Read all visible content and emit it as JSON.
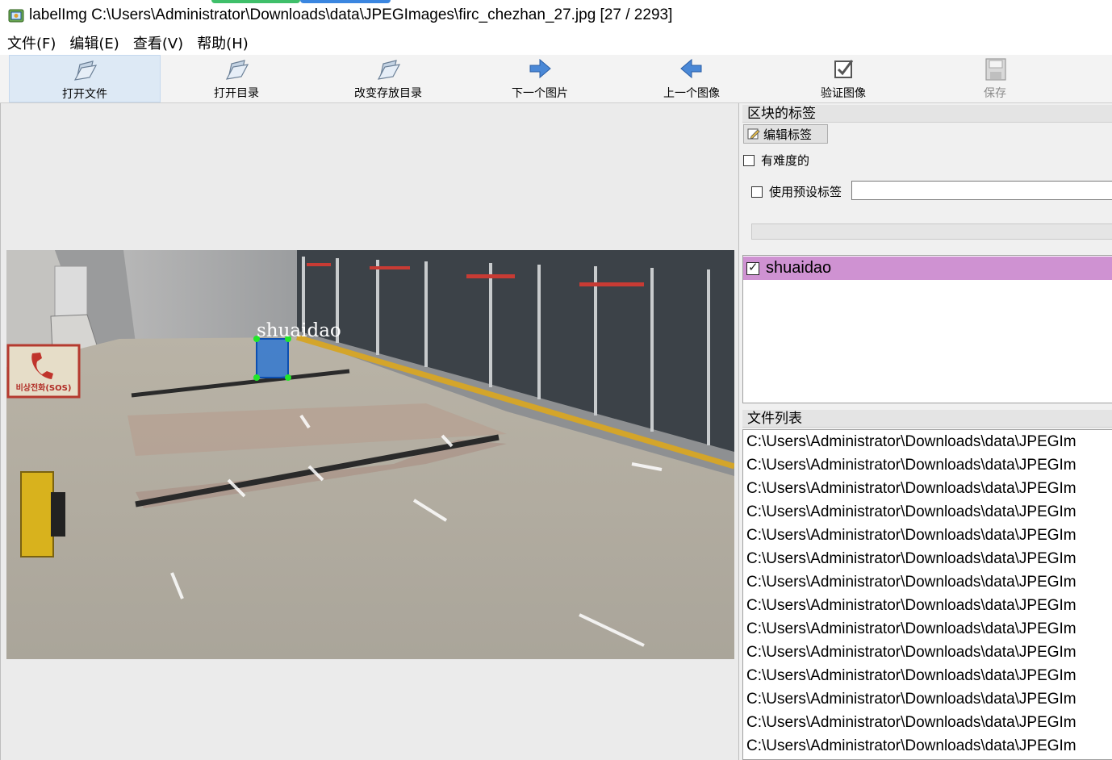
{
  "window": {
    "title": "labelImg C:\\Users\\Administrator\\Downloads\\data\\JPEGImages\\firc_chezhan_27.jpg [27 / 2293]"
  },
  "menu": [
    "文件(F)",
    "编辑(E)",
    "查看(V)",
    "帮助(H)"
  ],
  "toolbar": [
    {
      "label": "打开文件",
      "icon": "open-folder-icon",
      "active": true,
      "disabled": false
    },
    {
      "label": "打开目录",
      "icon": "open-folder-icon",
      "active": false,
      "disabled": false
    },
    {
      "label": "改变存放目录",
      "icon": "open-folder-icon",
      "active": false,
      "disabled": false
    },
    {
      "label": "下一个图片",
      "icon": "arrow-right-icon",
      "active": false,
      "disabled": false
    },
    {
      "label": "上一个图像",
      "icon": "arrow-left-icon",
      "active": false,
      "disabled": false
    },
    {
      "label": "验证图像",
      "icon": "check-box-icon",
      "active": false,
      "disabled": false
    },
    {
      "label": "保存",
      "icon": "save-disk-icon",
      "active": false,
      "disabled": true
    }
  ],
  "canvas": {
    "annotation_label": "shuaidao",
    "sign_text": "비상전화(SOS)"
  },
  "right_panel": {
    "box_labels_title": "区块的标签",
    "edit_label_button": "编辑标签",
    "difficult_label": "有难度的",
    "difficult_checked": false,
    "use_default_label": "使用预设标签",
    "use_default_checked": false,
    "default_label_value": "",
    "labels": [
      {
        "text": "shuaidao",
        "checked": true,
        "color": "#cf92d2"
      }
    ],
    "file_list_title": "文件列表",
    "files": [
      "C:\\Users\\Administrator\\Downloads\\data\\JPEGIm",
      "C:\\Users\\Administrator\\Downloads\\data\\JPEGIm",
      "C:\\Users\\Administrator\\Downloads\\data\\JPEGIm",
      "C:\\Users\\Administrator\\Downloads\\data\\JPEGIm",
      "C:\\Users\\Administrator\\Downloads\\data\\JPEGIm",
      "C:\\Users\\Administrator\\Downloads\\data\\JPEGIm",
      "C:\\Users\\Administrator\\Downloads\\data\\JPEGIm",
      "C:\\Users\\Administrator\\Downloads\\data\\JPEGIm",
      "C:\\Users\\Administrator\\Downloads\\data\\JPEGIm",
      "C:\\Users\\Administrator\\Downloads\\data\\JPEGIm",
      "C:\\Users\\Administrator\\Downloads\\data\\JPEGIm",
      "C:\\Users\\Administrator\\Downloads\\data\\JPEGIm",
      "C:\\Users\\Administrator\\Downloads\\data\\JPEGIm",
      "C:\\Users\\Administrator\\Downloads\\data\\JPEGIm"
    ]
  },
  "colors": {
    "label_highlight": "#cf92d2",
    "bbox_fill": "#1f6fd6",
    "bbox_handle": "#22e62a",
    "active_tool_bg": "#dde9f5"
  }
}
